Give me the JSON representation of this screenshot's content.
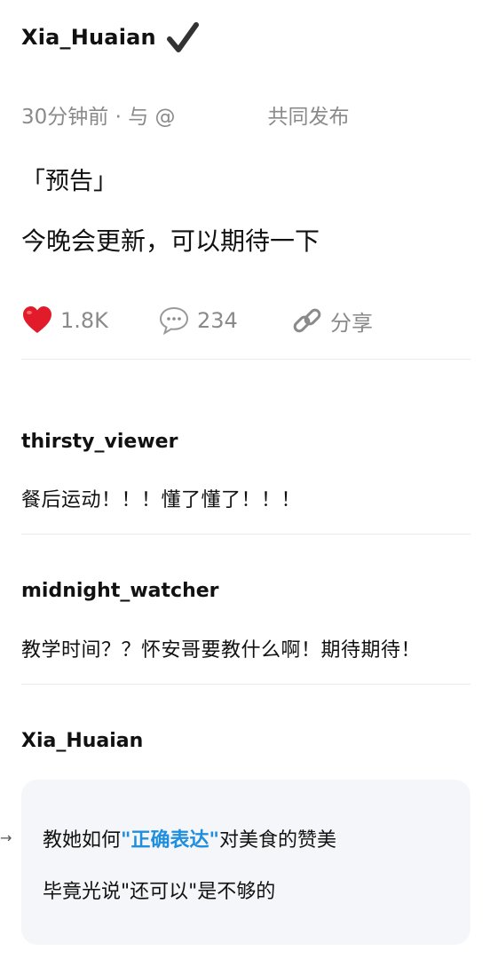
{
  "post": {
    "author": "Xia_Huaian",
    "meta_time": "30分钟前 · 与 @",
    "meta_suffix": "共同发布",
    "line1": "「预告」",
    "line2": "今晚会更新，可以期待一下",
    "likes": "1.8K",
    "comments": "234",
    "share_label": "分享"
  },
  "comments": [
    {
      "user": "thirsty_viewer",
      "text": "餐后运动！！！懂了懂了！！！"
    },
    {
      "user": "midnight_watcher",
      "text": "教学时间？？怀安哥要教什么啊！期待期待！"
    }
  ],
  "reply": {
    "user": "Xia_Huaian",
    "line1_pre": "教她如何",
    "line1_highlight": "\"正确表达\"",
    "line1_post": "对美食的赞美",
    "line2": "毕竟光说\"还可以\"是不够的",
    "arrow": "→"
  },
  "icons": {
    "verified": "checkmark-icon",
    "like": "heart-icon",
    "comment": "speech-bubble-icon",
    "share": "link-icon"
  },
  "colors": {
    "heart": "#e21b2b",
    "highlight": "#1f8fdd",
    "muted": "#8a8a8a"
  }
}
